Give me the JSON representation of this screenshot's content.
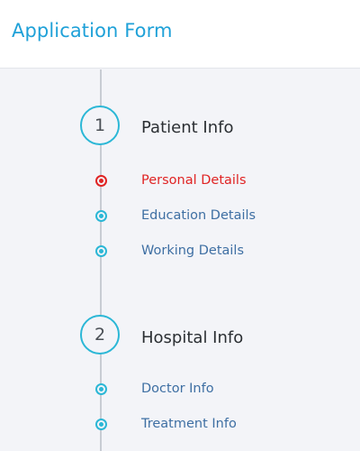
{
  "header": {
    "title": "Application Form"
  },
  "steps": [
    {
      "number": "1",
      "title": "Patient Info",
      "substeps": [
        {
          "label": "Personal Details",
          "active": true
        },
        {
          "label": "Education Details",
          "active": false
        },
        {
          "label": "Working Details",
          "active": false
        }
      ]
    },
    {
      "number": "2",
      "title": "Hospital Info",
      "substeps": [
        {
          "label": "Doctor Info",
          "active": false
        },
        {
          "label": "Treatment Info",
          "active": false
        }
      ]
    }
  ],
  "colors": {
    "accent": "#2bb7d6",
    "title_blue": "#1fa1d8",
    "active_red": "#e02424",
    "link_blue": "#3e6fa3"
  }
}
